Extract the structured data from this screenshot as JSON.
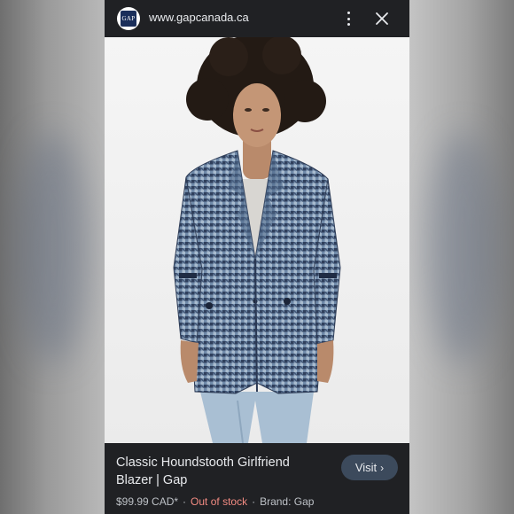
{
  "browser": {
    "url": "www.gapcanada.ca",
    "logo_text": "GAP",
    "menu_icon": "more-vert-icon",
    "close_icon": "close-icon"
  },
  "product": {
    "image_alt": "Model wearing blue houndstooth blazer",
    "title": "Classic Houndstooth Girlfriend Blazer | Gap",
    "price": "$99.99 CAD*",
    "stock_status": "Out of stock",
    "brand": "Brand: Gap",
    "separator": "·"
  },
  "actions": {
    "visit_label": "Visit",
    "visit_chevron": "›"
  },
  "colors": {
    "background": "#202124",
    "text": "#e8eaed",
    "out_of_stock": "#f28b82",
    "visit_button": "#3c4a5c"
  }
}
